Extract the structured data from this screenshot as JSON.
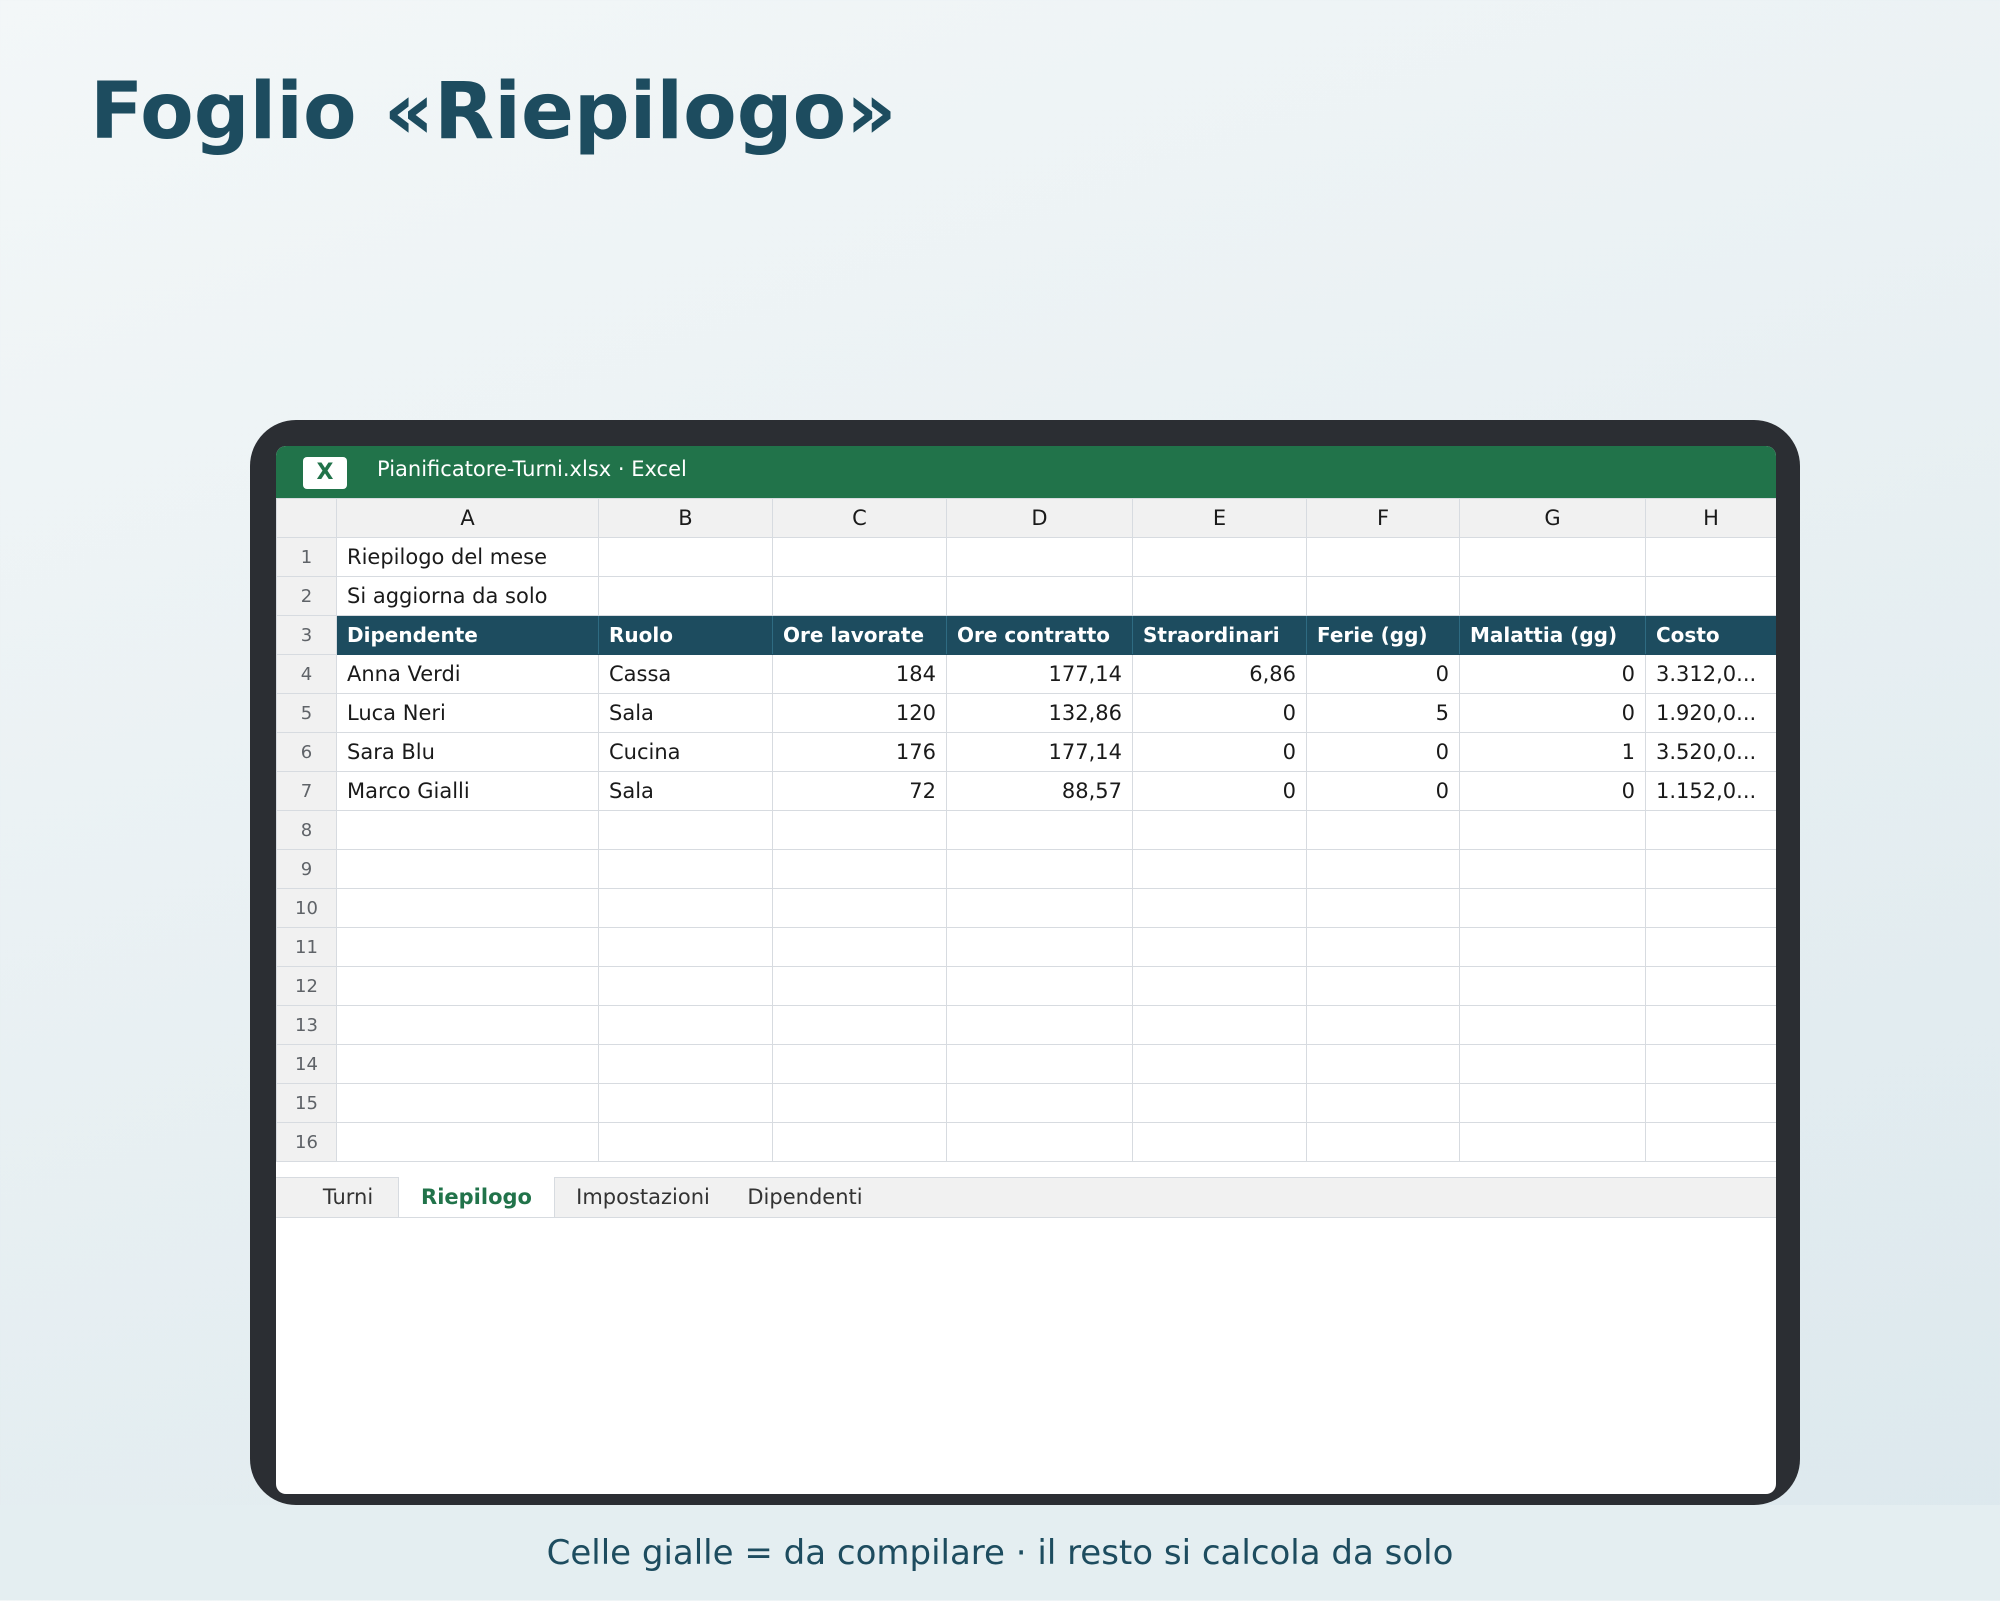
{
  "page": {
    "title": "Foglio «Riepilogo»",
    "caption": "Celle gialle = da compilare · il resto si calcola da solo"
  },
  "window": {
    "app_icon": "X",
    "title": "Pianificatore-Turni.xlsx · Excel"
  },
  "sheet": {
    "columns": [
      "A",
      "B",
      "C",
      "D",
      "E",
      "F",
      "G",
      "H"
    ],
    "row_numbers": [
      "1",
      "2",
      "3",
      "4",
      "5",
      "6",
      "7",
      "8",
      "9",
      "10",
      "11",
      "12",
      "13",
      "14",
      "15",
      "16"
    ],
    "title": "Riepilogo del mese",
    "subtitle": "Si aggiorna da solo",
    "headers": [
      "Dipendente",
      "Ruolo",
      "Ore lavorate",
      "Ore contratto",
      "Straordinari",
      "Ferie (gg)",
      "Malattia (gg)",
      "Costo"
    ],
    "rows": [
      [
        "Anna Verdi",
        "Cassa",
        "184",
        "177,14",
        "6,86",
        "0",
        "0",
        "3.312,0..."
      ],
      [
        "Luca Neri",
        "Sala",
        "120",
        "132,86",
        "0",
        "5",
        "0",
        "1.920,0..."
      ],
      [
        "Sara Blu",
        "Cucina",
        "176",
        "177,14",
        "0",
        "0",
        "1",
        "3.520,0..."
      ],
      [
        "Marco Gialli",
        "Sala",
        "72",
        "88,57",
        "0",
        "0",
        "0",
        "1.152,0..."
      ]
    ]
  },
  "tabs": [
    {
      "label": "Turni",
      "active": false
    },
    {
      "label": "Riepilogo",
      "active": true
    },
    {
      "label": "Impostazioni",
      "active": false
    },
    {
      "label": "Dipendenti",
      "active": false
    }
  ],
  "colors": {
    "excel_green": "#21734a",
    "header_teal": "#1d4c5f",
    "device_frame": "#2b2e33"
  }
}
